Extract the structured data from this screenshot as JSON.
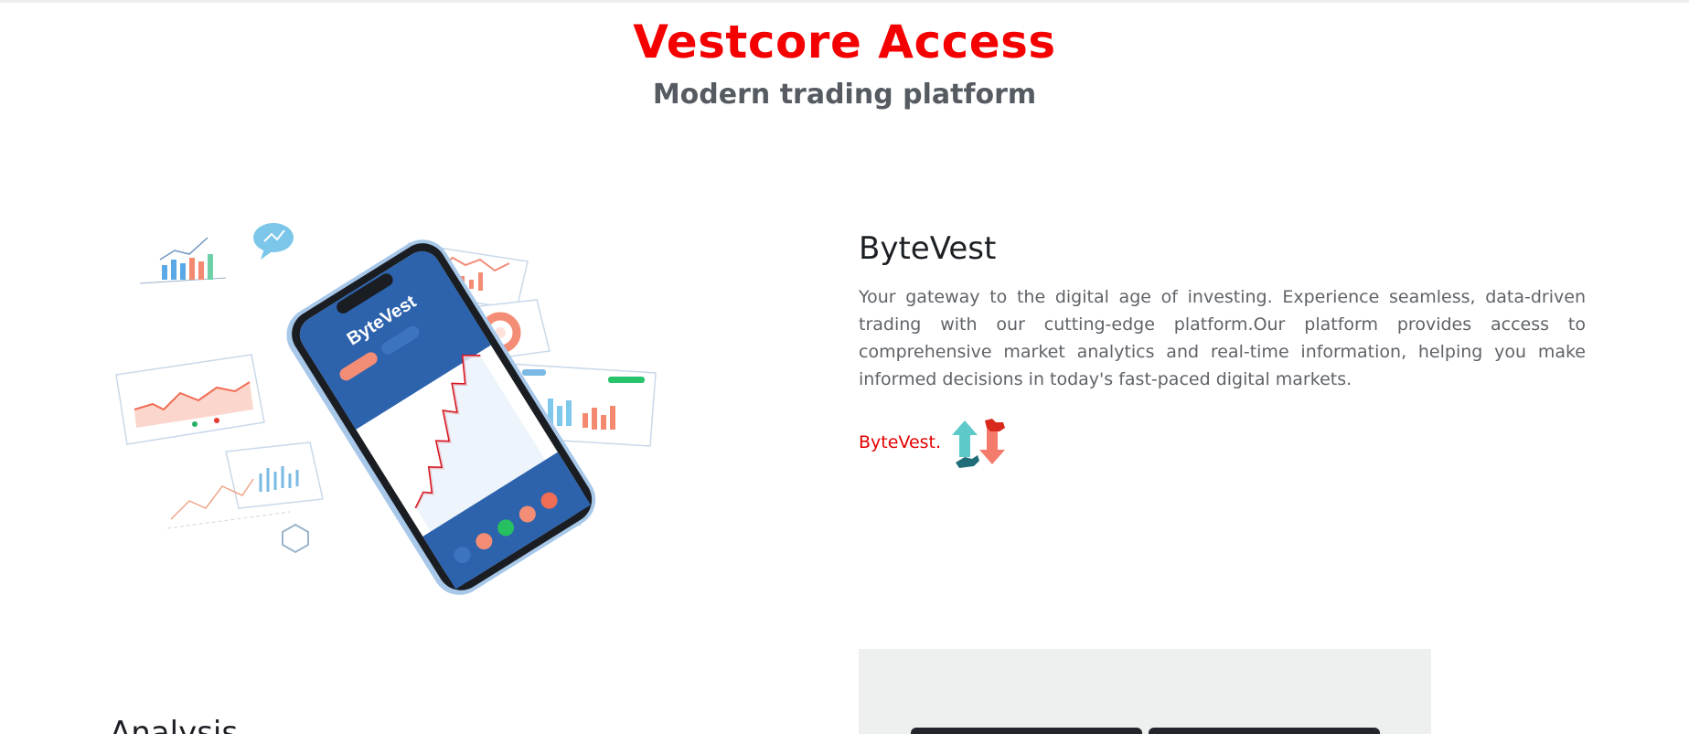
{
  "header": {
    "title": "Vestcore Access",
    "subtitle": "Modern trading platform"
  },
  "hero": {
    "image_alt": "ByteVest trading app on a smartphone surrounded by market charts",
    "phone_brand": "ByteVest"
  },
  "info": {
    "title": "ByteVest",
    "body": "Your gateway to the digital age of investing. Experience seamless, data-driven trading with our cutting-edge platform.Our platform provides access to comprehensive market analytics and real-time information, helping you make informed decisions in today's fast-paced digital markets.",
    "brand_text": "ByteVest.",
    "brand_icon": "bull-bear-arrows-icon"
  },
  "analysis": {
    "title": "Analysis"
  },
  "colors": {
    "accent": "#f40000",
    "subtitle": "#555b61",
    "body_text": "#5f6368"
  }
}
